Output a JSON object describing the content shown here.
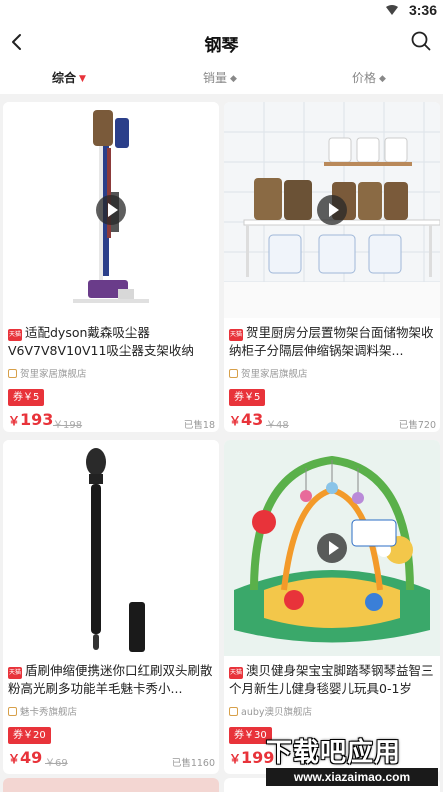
{
  "status_bar": {
    "time": "3:36"
  },
  "header": {
    "title": "钢琴"
  },
  "sort": [
    {
      "label": "综合",
      "active": true,
      "icon": "chevron-down-icon"
    },
    {
      "label": "销量",
      "active": false,
      "icon": "sort-icon"
    },
    {
      "label": "价格",
      "active": false,
      "icon": "sort-icon"
    }
  ],
  "mall_badge": "天猫",
  "products": [
    {
      "title": "适配dyson戴森吸尘器V6V7V8V10V11吸尘器支架收纳架...",
      "shop": "贺里家居旗舰店",
      "coupon": "券￥5",
      "price": "193",
      "old_price": "￥198",
      "sold": "已售18"
    },
    {
      "title": "贺里厨房分层置物架台面储物架收纳柜子分隔层伸缩锅架调料架...",
      "shop": "贺里家居旗舰店",
      "coupon": "券￥5",
      "price": "43",
      "old_price": "￥48",
      "sold": "已售720"
    },
    {
      "title": "盾刷伸缩便携迷你口红刷双头刷散粉高光刷多功能羊毛魅卡秀小...",
      "shop": "魅卡秀旗舰店",
      "coupon": "券￥20",
      "price": "49",
      "old_price": "￥69",
      "sold": "已售1160"
    },
    {
      "title": "澳贝健身架宝宝脚踏琴钢琴益智三个月新生儿健身毯婴儿玩具0-1岁",
      "shop": "auby澳贝旗舰店",
      "coupon": "券￥30",
      "price": "199",
      "old_price": "",
      "sold": ""
    }
  ],
  "watermark": {
    "main": "下载吧应用",
    "url": "www.xiazaimao.com"
  },
  "colors": {
    "accent": "#e8333a",
    "page_bg": "#f2f2f2"
  }
}
